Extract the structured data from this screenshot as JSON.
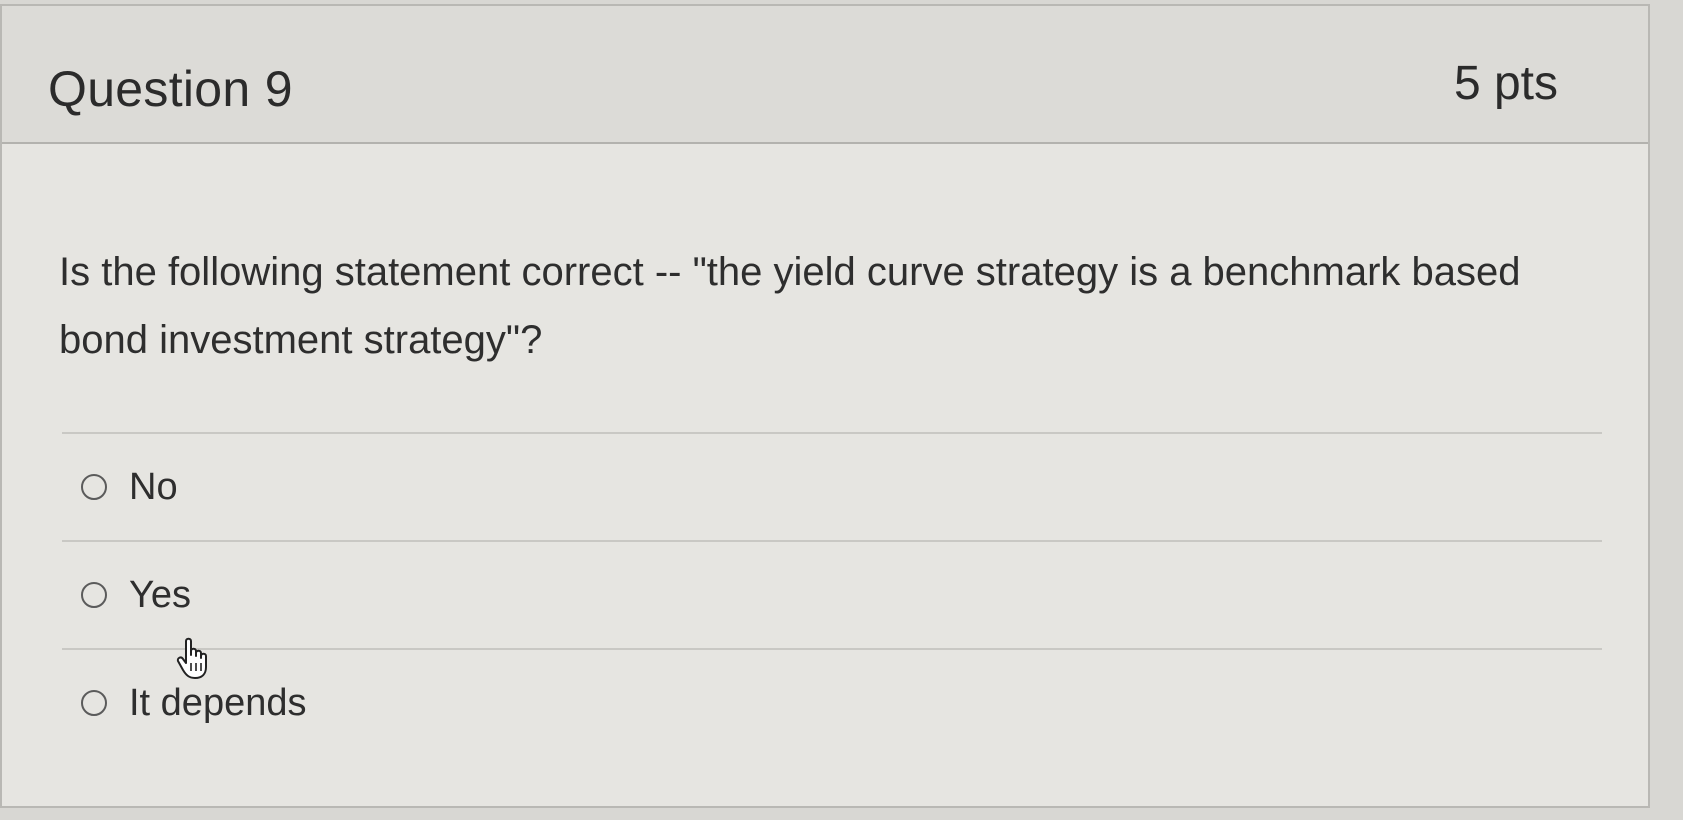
{
  "question": {
    "title": "Question 9",
    "points": "5 pts",
    "text": "Is the following statement correct -- \"the yield curve strategy is a benchmark based bond investment strategy\"?"
  },
  "answers": [
    {
      "label": "No",
      "selected": false
    },
    {
      "label": "Yes",
      "selected": false
    },
    {
      "label": "It depends",
      "selected": false
    }
  ],
  "cursor": {
    "icon": "hand-pointer-icon"
  }
}
